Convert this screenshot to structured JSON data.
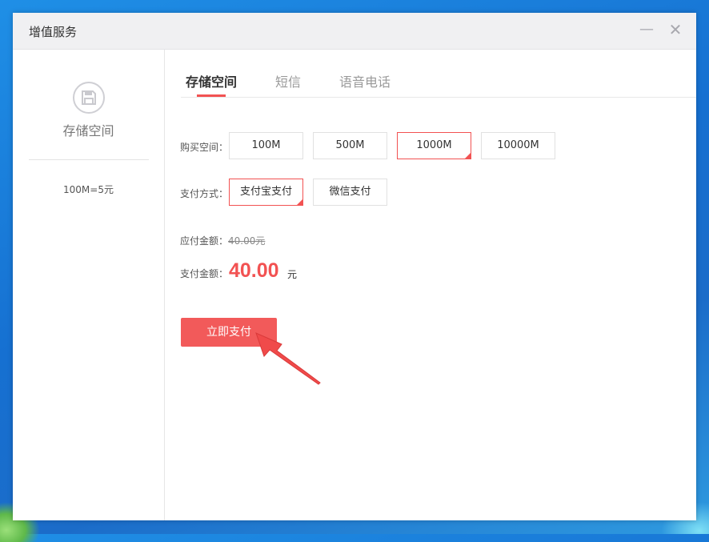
{
  "window": {
    "title": "增值服务"
  },
  "controls": {
    "minimize": "—",
    "close": "✕"
  },
  "sidebar": {
    "icon": "floppy-disk-icon",
    "label": "存储空间",
    "price_note": "100M=5元"
  },
  "tabs": [
    {
      "label": "存储空间",
      "active": true
    },
    {
      "label": "短信",
      "active": false
    },
    {
      "label": "语音电话",
      "active": false
    }
  ],
  "purchase": {
    "label": "购买空间：",
    "options": [
      "100M",
      "500M",
      "1000M",
      "10000M"
    ],
    "selected": "1000M"
  },
  "payment": {
    "label": "支付方式：",
    "options": [
      "支付宝支付",
      "微信支付"
    ],
    "selected": "支付宝支付"
  },
  "amount": {
    "due_label": "应付金额：",
    "due_value": "40.00元",
    "pay_label": "支付金额：",
    "pay_value": "40.00",
    "pay_unit": "元"
  },
  "pay_button": "立即支付",
  "colors": {
    "accent": "#f25252",
    "button": "#f25a5a",
    "annotation_arrow": "#f04a4a"
  }
}
